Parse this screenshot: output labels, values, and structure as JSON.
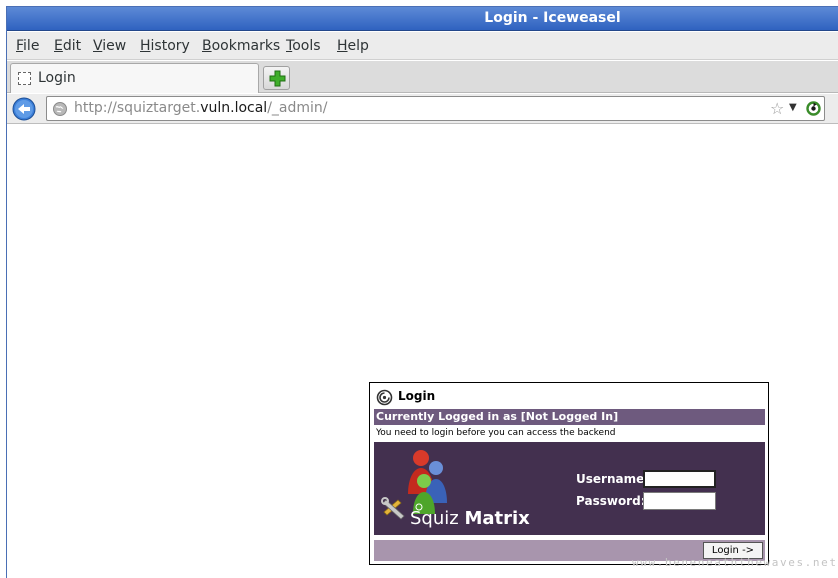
{
  "window": {
    "title": "Login - Iceweasel"
  },
  "menu": [
    "File",
    "Edit",
    "View",
    "History",
    "Bookmarks",
    "Tools",
    "Help"
  ],
  "tabs": [
    {
      "label": "Login"
    }
  ],
  "urlbar": {
    "prefix": "http://squiztarget.",
    "host": "vuln.local",
    "path": "/_admin/"
  },
  "icons": {
    "back": "back-arrow-icon",
    "new_tab": "plus-icon",
    "site": "globe-icon",
    "bookmark": "star-icon",
    "history": "dropdown-arrow-icon",
    "reload": "reload-icon",
    "login": "squiz-swirl-icon"
  },
  "login": {
    "title": "Login",
    "status": "Currently Logged in as [Not Logged In]",
    "message": "You need to login before you can access the backend",
    "brand_a": "Squiz",
    "brand_b": "Matrix",
    "username_label": "Username:",
    "username_value": "",
    "password_label": "Password:",
    "password_value": "",
    "button": "Login ->"
  },
  "watermark": "www.beneneaththewaves.net",
  "colors": {
    "titlebar": "#2f62c0",
    "panel": "#43304f",
    "status_bar": "#6e5a7e",
    "footer": "#a895ad"
  }
}
